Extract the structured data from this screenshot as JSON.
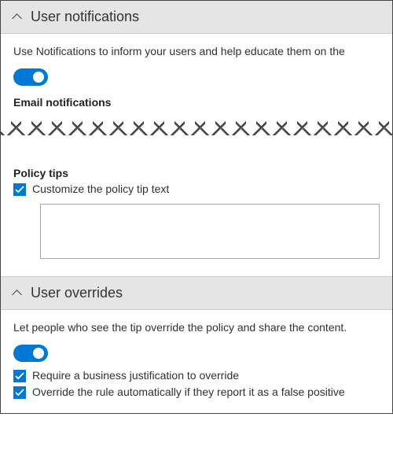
{
  "sections": {
    "notifications": {
      "title": "User notifications",
      "description": "Use Notifications to inform your users and help educate them on the",
      "toggle_on": true,
      "email_heading": "Email notifications",
      "policy_tips_heading": "Policy tips",
      "customize_label": "Customize the policy tip text",
      "customize_checked": true,
      "textarea_value": ""
    },
    "overrides": {
      "title": "User overrides",
      "description": "Let people who see the tip override the policy and share the content.",
      "toggle_on": true,
      "require_label": "Require a business justification to override",
      "require_checked": true,
      "false_positive_label": "Override the rule automatically if they report it as a false positive",
      "false_positive_checked": true
    }
  },
  "colors": {
    "accent": "#0078d4"
  }
}
